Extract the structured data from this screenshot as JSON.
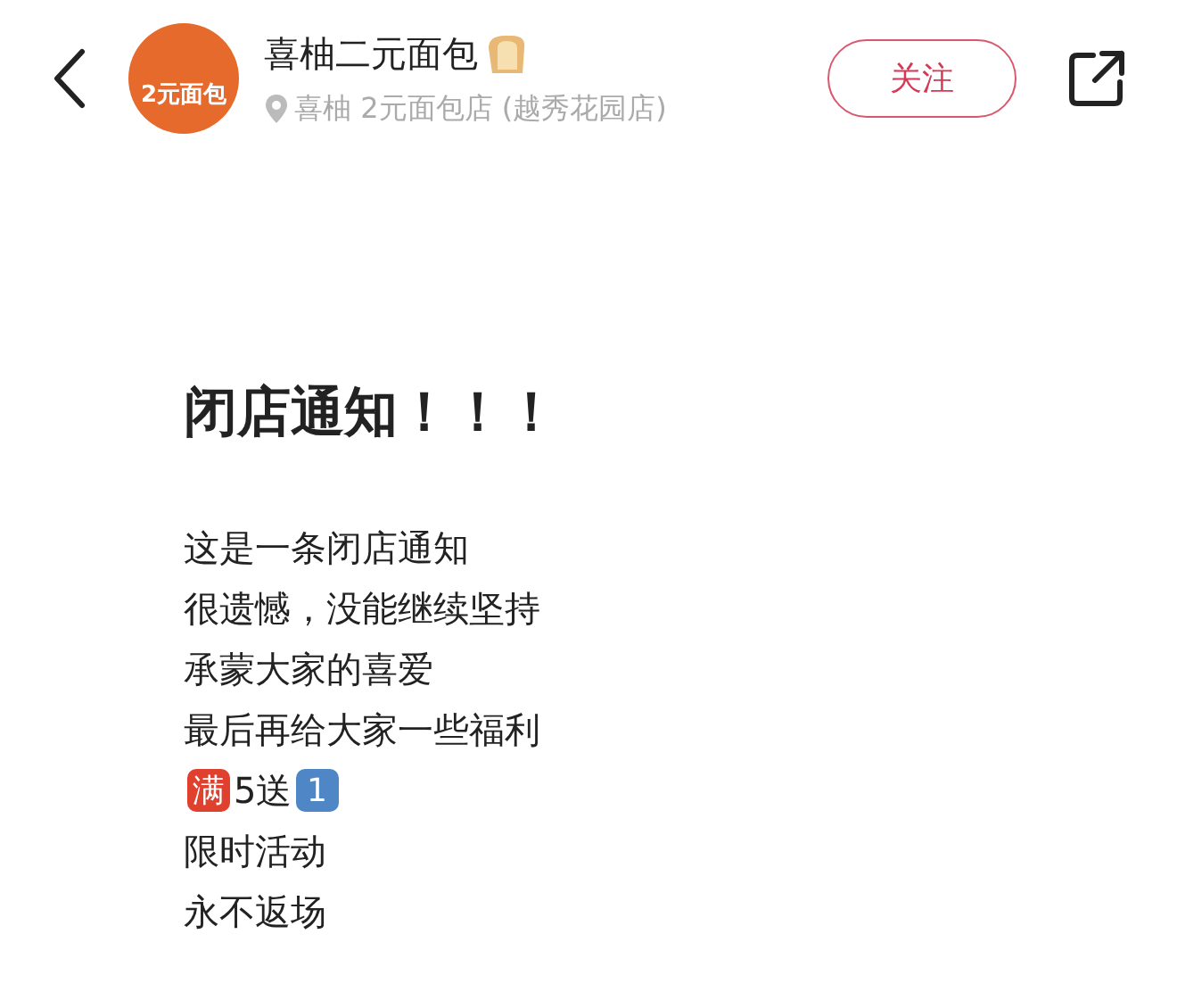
{
  "header": {
    "avatar_text": "2元面包",
    "name": "喜柚二元面包",
    "location": "喜柚 2元面包店 (越秀花园店)",
    "follow_button": "关注"
  },
  "post": {
    "title": "闭店通知！！！",
    "lines": [
      {
        "segments": [
          {
            "kind": "text",
            "text": "这是一条闭店通知"
          }
        ]
      },
      {
        "segments": [
          {
            "kind": "text",
            "text": "很遗憾，没能继续坚持"
          }
        ]
      },
      {
        "segments": [
          {
            "kind": "text",
            "text": "承蒙大家的喜爱"
          }
        ]
      },
      {
        "segments": [
          {
            "kind": "text",
            "text": "最后再给大家一些福利"
          }
        ]
      },
      {
        "segments": [
          {
            "kind": "badge",
            "text": "满",
            "color": "#e0402e"
          },
          {
            "kind": "text",
            "text": "5送"
          },
          {
            "kind": "badge",
            "text": "1",
            "color": "#4f86c6"
          }
        ]
      },
      {
        "segments": [
          {
            "kind": "text",
            "text": "限时活动"
          }
        ]
      },
      {
        "segments": [
          {
            "kind": "text",
            "text": "永不返场"
          }
        ]
      }
    ]
  }
}
